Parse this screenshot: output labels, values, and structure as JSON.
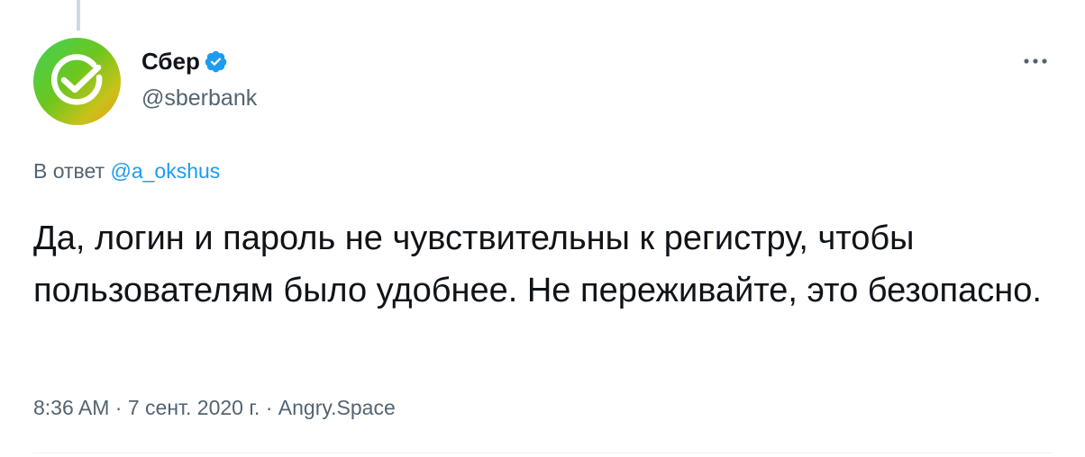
{
  "tweet": {
    "author": {
      "display_name": "Сбер",
      "handle": "@sberbank",
      "verified": true,
      "avatar_icon": "sber-logo-icon"
    },
    "reply": {
      "prefix": "В ответ",
      "to_handle": "@a_okshus"
    },
    "text": "Да, логин и пароль не чувствительны к регистру, чтобы пользователям было удобнее. Не переживайте, это безопасно.",
    "meta": {
      "time": "8:36 AM",
      "separator": "·",
      "date": "7 сент. 2020 г.",
      "source": "Angry.Space"
    }
  },
  "colors": {
    "text_primary": "#0f1419",
    "text_secondary": "#536471",
    "accent": "#1d9bf0",
    "thread_line": "#cfd9de"
  }
}
